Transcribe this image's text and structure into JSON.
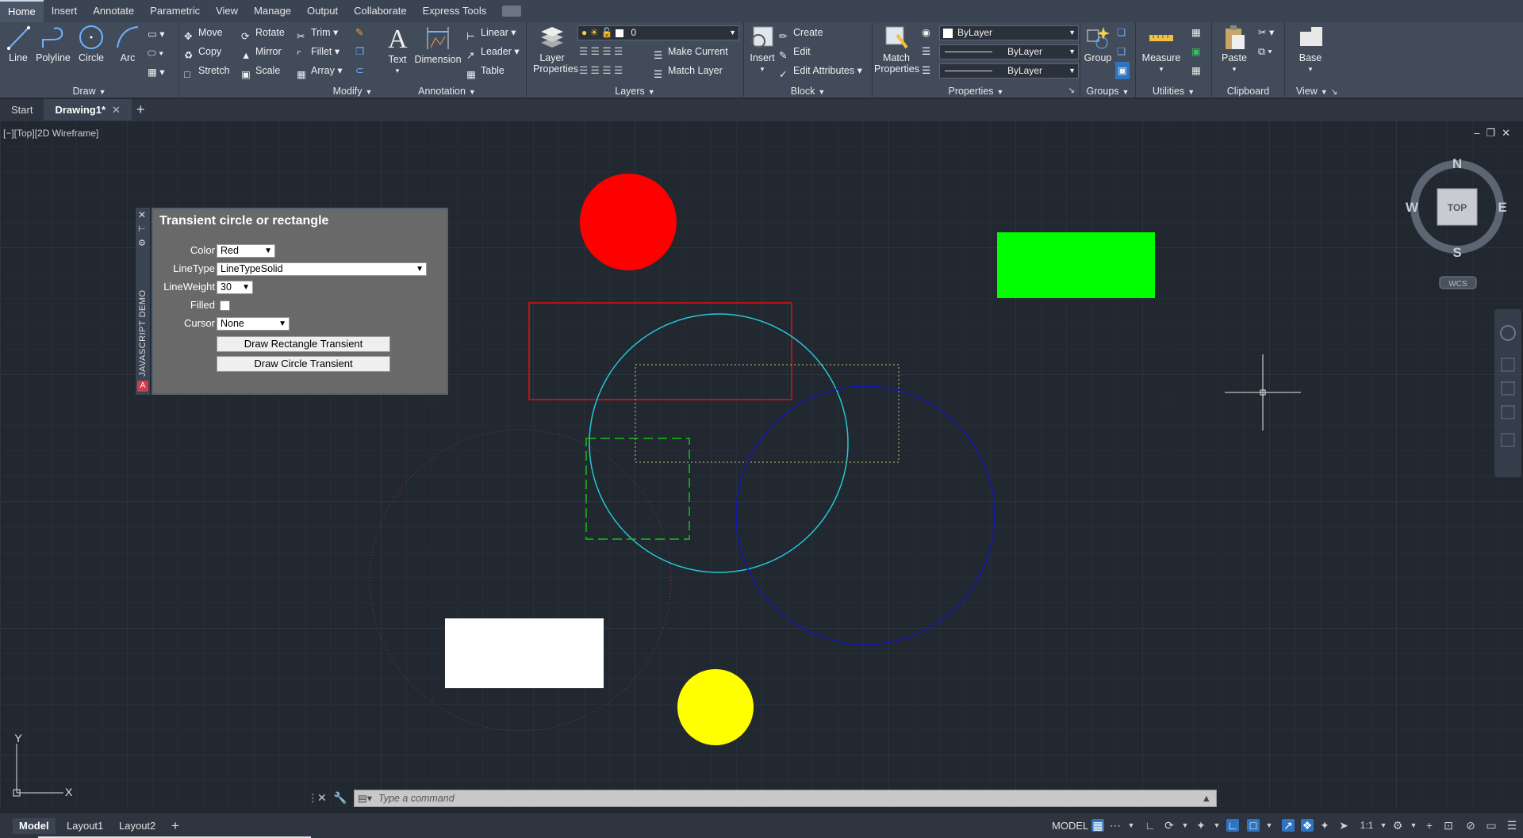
{
  "ribbon_tabs": [
    "Home",
    "Insert",
    "Annotate",
    "Parametric",
    "View",
    "Manage",
    "Output",
    "Collaborate",
    "Express Tools"
  ],
  "active_tab": "Home",
  "panels": {
    "draw": {
      "title": "Draw",
      "line": "Line",
      "polyline": "Polyline",
      "circle": "Circle",
      "arc": "Arc"
    },
    "modify": {
      "title": "Modify",
      "move": "Move",
      "rotate": "Rotate",
      "trim": "Trim",
      "copy": "Copy",
      "mirror": "Mirror",
      "fillet": "Fillet",
      "stretch": "Stretch",
      "scale": "Scale",
      "array": "Array"
    },
    "annotation": {
      "title": "Annotation",
      "text": "Text",
      "dimension": "Dimension",
      "linear": "Linear",
      "leader": "Leader",
      "table": "Table"
    },
    "layers": {
      "title": "Layers",
      "layer_properties_1": "Layer",
      "layer_properties_2": "Properties",
      "layer_value": "0",
      "make_current": "Make Current",
      "match_layer": "Match Layer"
    },
    "block": {
      "title": "Block",
      "insert": "Insert",
      "create": "Create",
      "edit": "Edit",
      "edit_attributes": "Edit Attributes"
    },
    "properties": {
      "title": "Properties",
      "match_1": "Match",
      "match_2": "Properties",
      "color": "ByLayer",
      "linetype": "ByLayer",
      "lineweight": "ByLayer"
    },
    "groups": {
      "title": "Groups",
      "group": "Group"
    },
    "utilities": {
      "title": "Utilities",
      "measure": "Measure"
    },
    "clipboard": {
      "title": "Clipboard",
      "paste": "Paste"
    },
    "view": {
      "title": "View",
      "base": "Base"
    }
  },
  "file_tabs": {
    "start": "Start",
    "drawing": "Drawing1*"
  },
  "viewport_label": "[−][Top][2D Wireframe]",
  "viewcube": {
    "n": "N",
    "s": "S",
    "e": "E",
    "w": "W",
    "face": "TOP",
    "wcs": "WCS"
  },
  "ucs": {
    "x": "X",
    "y": "Y"
  },
  "palette": {
    "side_label": "JAVASCRIPT DEMO",
    "title": "Transient circle or rectangle",
    "color_label": "Color",
    "color_value": "Red",
    "linetype_label": "LineType",
    "linetype_value": "LineTypeSolid",
    "lineweight_label": "LineWeight",
    "lineweight_value": "30",
    "filled_label": "Filled",
    "filled_checked": false,
    "cursor_label": "Cursor",
    "cursor_value": "None",
    "draw_rect_button": "Draw Rectangle Transient",
    "draw_circle_button": "Draw Circle Transient"
  },
  "command": {
    "placeholder": "Type a command"
  },
  "status": {
    "model": "Model",
    "layout1": "Layout1",
    "layout2": "Layout2",
    "model_label": "MODEL",
    "scale": "1:1"
  },
  "colors": {
    "red": "#ff0000",
    "green": "#00ff00",
    "yellow": "#ffff00",
    "white": "#ffffff",
    "cyan": "#25c8d8",
    "blue": "#1616b4",
    "magenta": "#8a2a8a",
    "accent": "#2f74c0"
  }
}
